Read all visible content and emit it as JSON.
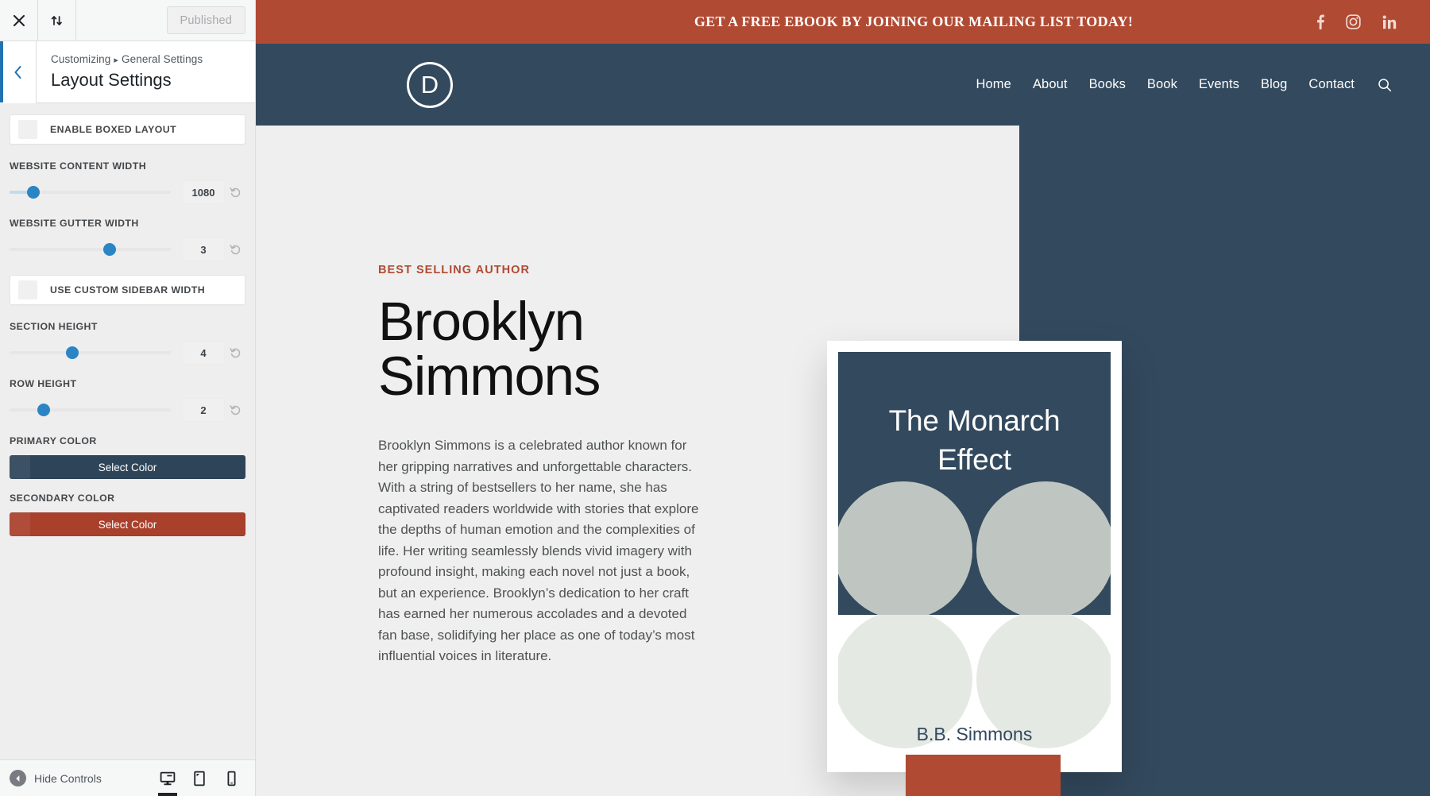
{
  "customizer": {
    "topbar": {
      "close_icon": "close-icon",
      "devices_icon": "collapse-arrows-icon",
      "publish_label": "Published"
    },
    "header": {
      "back_icon": "chevron-left-icon",
      "breadcrumb_root": "Customizing",
      "breadcrumb_separator": "▸",
      "breadcrumb_parent": "General Settings",
      "title": "Layout Settings"
    },
    "controls": [
      {
        "kind": "toggle",
        "label": "ENABLE BOXED LAYOUT",
        "checked": false
      },
      {
        "kind": "slider",
        "label": "WEBSITE CONTENT WIDTH",
        "value": "1080",
        "percent": 15,
        "filled": true
      },
      {
        "kind": "slider",
        "label": "WEBSITE GUTTER WIDTH",
        "value": "3",
        "percent": 62,
        "filled": false
      },
      {
        "kind": "toggle",
        "label": "USE CUSTOM SIDEBAR WIDTH",
        "checked": false
      },
      {
        "kind": "slider",
        "label": "SECTION HEIGHT",
        "value": "4",
        "percent": 39,
        "filled": false
      },
      {
        "kind": "slider",
        "label": "ROW HEIGHT",
        "value": "2",
        "percent": 21,
        "filled": false
      },
      {
        "kind": "color",
        "label": "PRIMARY COLOR",
        "button_label": "Select Color",
        "color": "#2e4559"
      },
      {
        "kind": "color",
        "label": "SECONDARY COLOR",
        "button_label": "Select Color",
        "color": "#a9402c"
      }
    ],
    "reset_icon": "reset-arrow-icon",
    "footer": {
      "hide_controls_label": "Hide Controls",
      "hide_controls_icon": "chevron-left-circle-icon",
      "devices": [
        {
          "name": "desktop",
          "icon": "desktop-icon",
          "active": true
        },
        {
          "name": "tablet",
          "icon": "tablet-icon",
          "active": false
        },
        {
          "name": "mobile",
          "icon": "mobile-icon",
          "active": false
        }
      ]
    }
  },
  "site": {
    "promo_bar": {
      "text": "GET A FREE EBOOK BY JOINING OUR MAILING LIST TODAY!",
      "background": "#b04a33",
      "socials": [
        {
          "name": "facebook-icon"
        },
        {
          "name": "instagram-icon"
        },
        {
          "name": "linkedin-icon"
        }
      ]
    },
    "header": {
      "background": "#33495d",
      "logo_letter": "D",
      "logo_name": "divi-logo",
      "nav": [
        {
          "label": "Home"
        },
        {
          "label": "About"
        },
        {
          "label": "Books"
        },
        {
          "label": "Book"
        },
        {
          "label": "Events"
        },
        {
          "label": "Blog"
        },
        {
          "label": "Contact"
        }
      ],
      "search_icon": "search-icon"
    },
    "hero": {
      "eyebrow": "BEST SELLING AUTHOR",
      "eyebrow_color": "#b04a33",
      "title": "Brooklyn Simmons",
      "paragraph": "Brooklyn Simmons is a celebrated author known for her gripping narratives and unforgettable characters. With a string of bestsellers to her name, she has captivated readers worldwide with stories that explore the depths of human emotion and the complexities of life. Her writing seamlessly blends vivid imagery with profound insight, making each novel not just a book, but an experience. Brooklyn’s dedication to her craft has earned her numerous accolades and a devoted fan base, solidifying her place as one of today’s most influential voices in literature.",
      "left_background": "#efefef",
      "right_background": "#33495d",
      "cta_color": "#b04a33"
    },
    "book_cover": {
      "title_line1": "The Monarch",
      "title_line2": "Effect",
      "author": "B.B. Simmons",
      "top_background": "#33495d",
      "wing_upper_color": "#bfc6c1",
      "wing_lower_color": "#e4e9e3",
      "card_background": "#ffffff"
    }
  }
}
